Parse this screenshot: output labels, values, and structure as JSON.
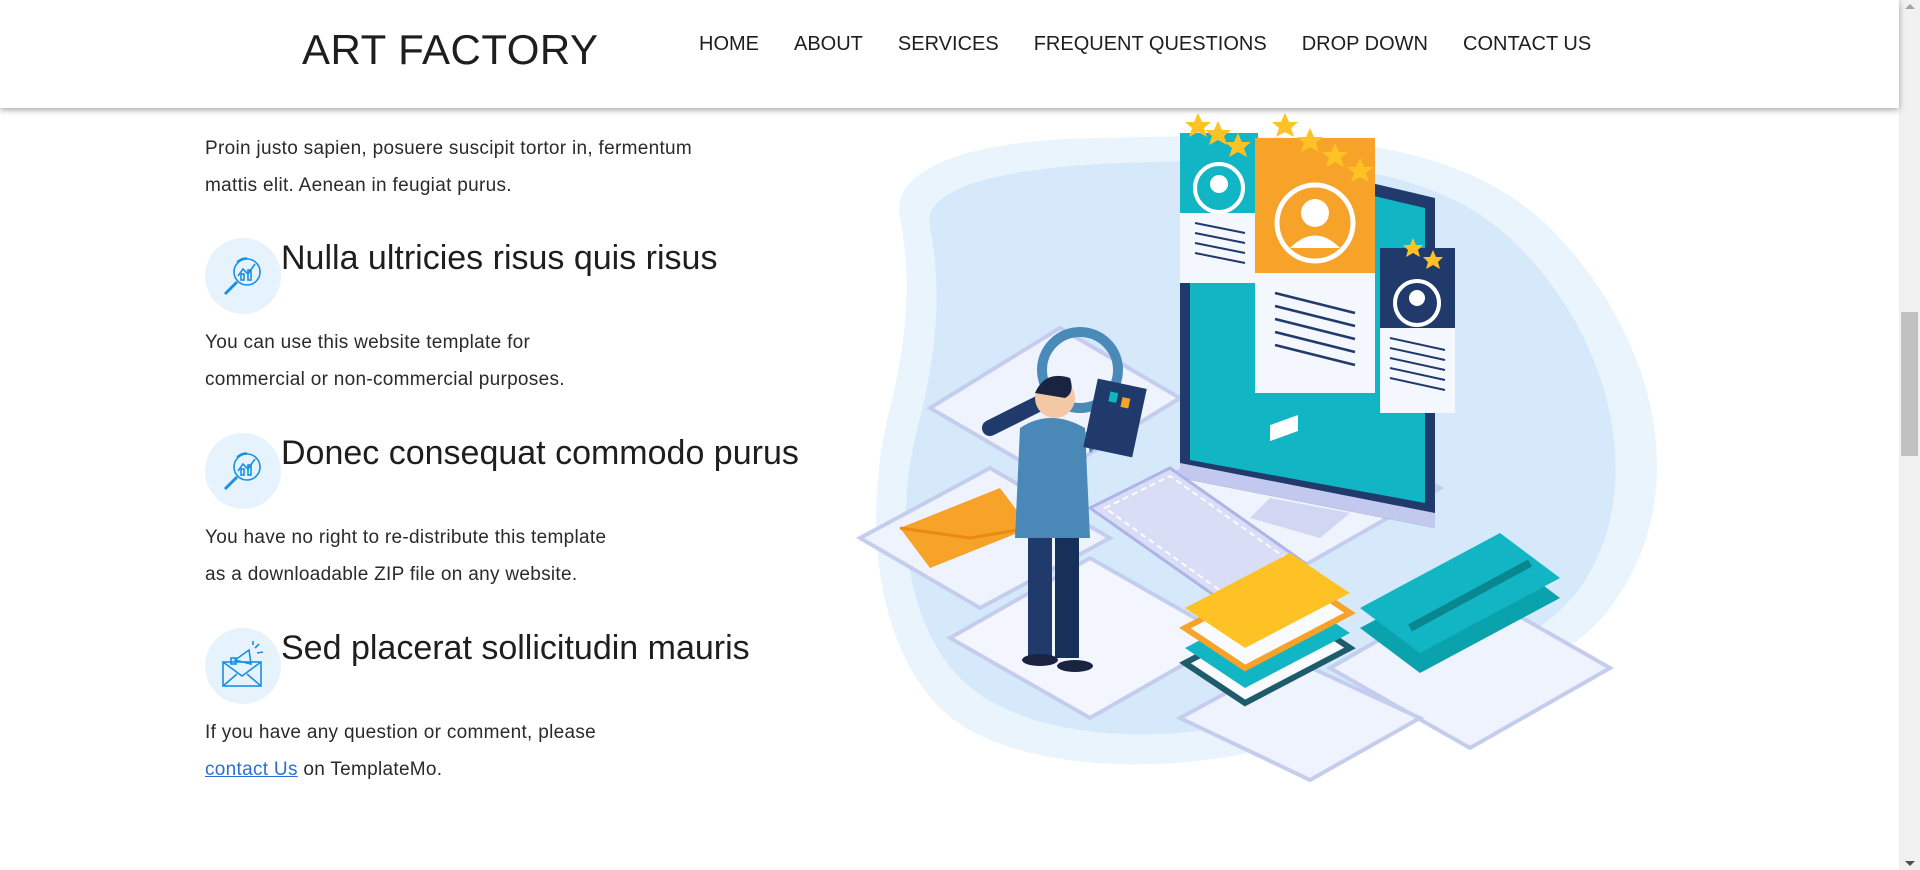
{
  "header": {
    "logo": "ART FACTORY",
    "nav": [
      "HOME",
      "ABOUT",
      "SERVICES",
      "FREQUENT QUESTIONS",
      "DROP DOWN",
      "CONTACT US"
    ]
  },
  "intro": {
    "line1": "Proin justo sapien, posuere suscipit tortor in, fermentum",
    "line2": "mattis elit. Aenean in feugiat purus."
  },
  "features": [
    {
      "icon": "chart-magnifier-icon",
      "title": "Nulla ultricies risus quis risus",
      "line1": "You can use this website template for",
      "line2": "commercial or non-commercial purposes."
    },
    {
      "icon": "chart-magnifier-icon",
      "title": "Donec consequat commodo purus",
      "line1": "You have no right to re-distribute this template",
      "line2": "as a downloadable ZIP file on any website."
    },
    {
      "icon": "envelope-megaphone-icon",
      "title": "Sed placerat sollicitudin mauris",
      "line1": "If you have any question or comment, please",
      "link": "contact Us",
      "line2_suffix": " on TemplateMo."
    }
  ],
  "colors": {
    "accent_blue": "#2a6fd6",
    "icon_bg": "#e6f3fd",
    "teal": "#12b5c4",
    "orange": "#f7a229",
    "navy": "#1f3a6b"
  }
}
